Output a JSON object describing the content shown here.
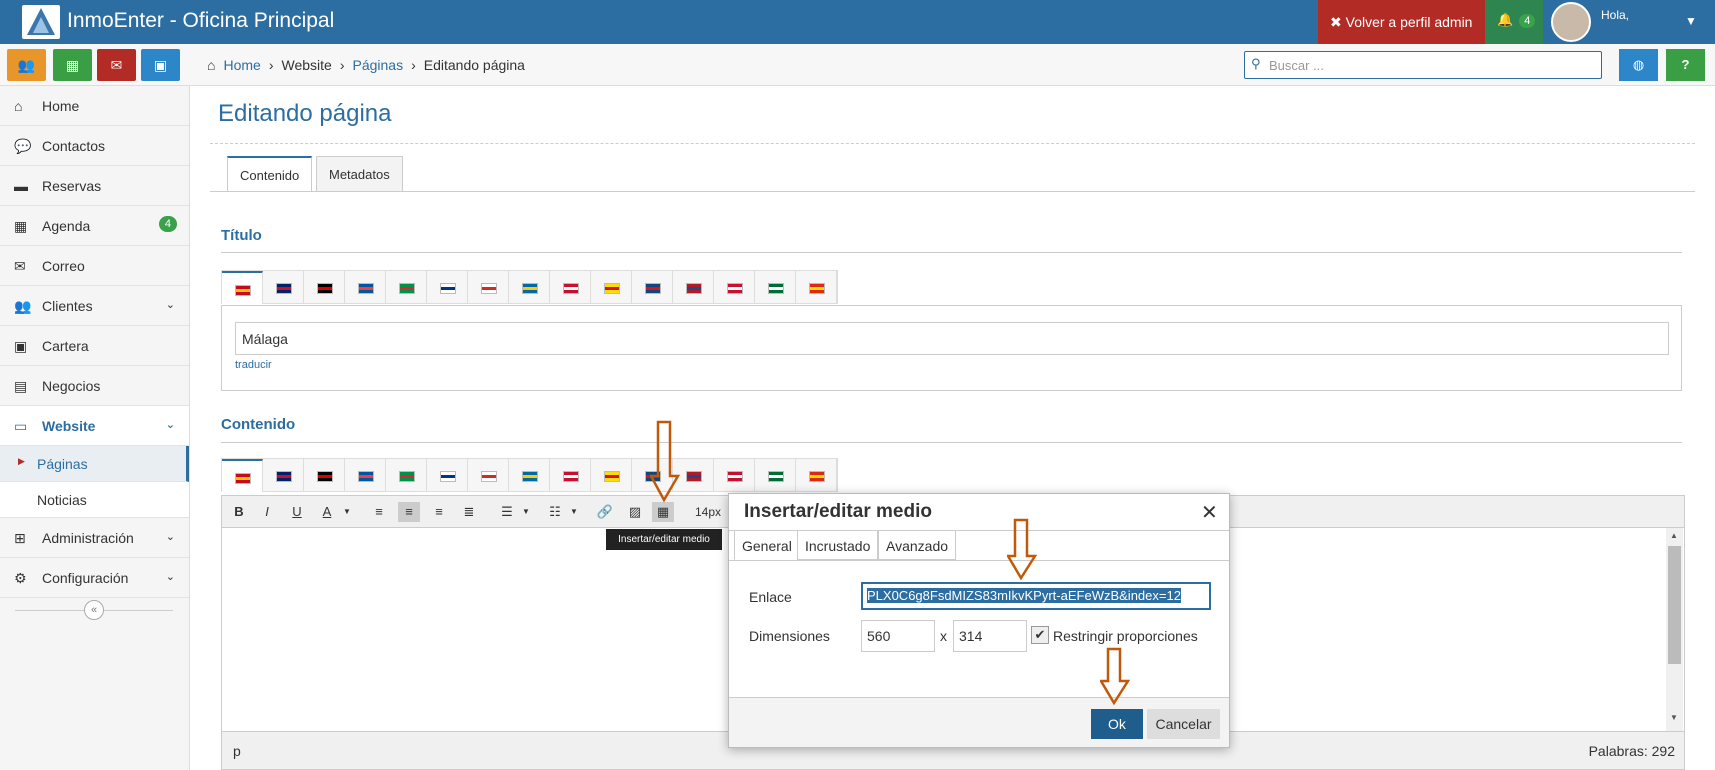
{
  "header": {
    "app_title": "InmoEnter - Oficina Principal",
    "admin_button": "Volver a perfil admin",
    "notif_count": "4",
    "greeting": "Hola,"
  },
  "breadcrumb": {
    "home": "Home",
    "website": "Website",
    "paginas": "Páginas",
    "current": "Editando página"
  },
  "search": {
    "placeholder": "Buscar ..."
  },
  "sidebar": {
    "items": [
      {
        "label": "Home",
        "icon": "home-icon"
      },
      {
        "label": "Contactos",
        "icon": "chat-icon"
      },
      {
        "label": "Reservas",
        "icon": "bed-icon"
      },
      {
        "label": "Agenda",
        "icon": "calendar-icon",
        "badge": "4"
      },
      {
        "label": "Correo",
        "icon": "envelope-icon"
      },
      {
        "label": "Clientes",
        "icon": "users-icon"
      },
      {
        "label": "Cartera",
        "icon": "briefcase-icon"
      },
      {
        "label": "Negocios",
        "icon": "money-icon"
      },
      {
        "label": "Website",
        "icon": "monitor-icon"
      },
      {
        "label": "Administración",
        "icon": "sitemap-icon"
      },
      {
        "label": "Configuración",
        "icon": "gears-icon"
      }
    ],
    "sub_items": [
      "Páginas",
      "Noticias"
    ]
  },
  "main": {
    "page_title": "Editando página",
    "tabs": [
      "Contenido",
      "Metadatos"
    ],
    "section_titulo": "Título",
    "title_value": "Málaga",
    "traducir": "traducir",
    "section_contenido": "Contenido"
  },
  "editor": {
    "font_size": "14px",
    "tooltip": "Insertar/editar medio",
    "status_element": "p",
    "word_count": "Palabras: 292"
  },
  "dialog": {
    "title": "Insertar/editar medio",
    "tabs": [
      "General",
      "Incrustado",
      "Avanzado"
    ],
    "link_label": "Enlace",
    "link_value": "PLX0C6g8FsdMIZS83mIkvKPyrt-aEFeWzB&index=12",
    "dims_label": "Dimensiones",
    "width": "560",
    "height": "314",
    "x": "x",
    "constrain_label": "Restringir proporciones",
    "ok": "Ok",
    "cancel": "Cancelar"
  },
  "colors": {
    "brand": "#2c6ea1",
    "danger": "#b32b25",
    "success": "#2e8550",
    "annotation_arrow": "#c05a0a"
  }
}
